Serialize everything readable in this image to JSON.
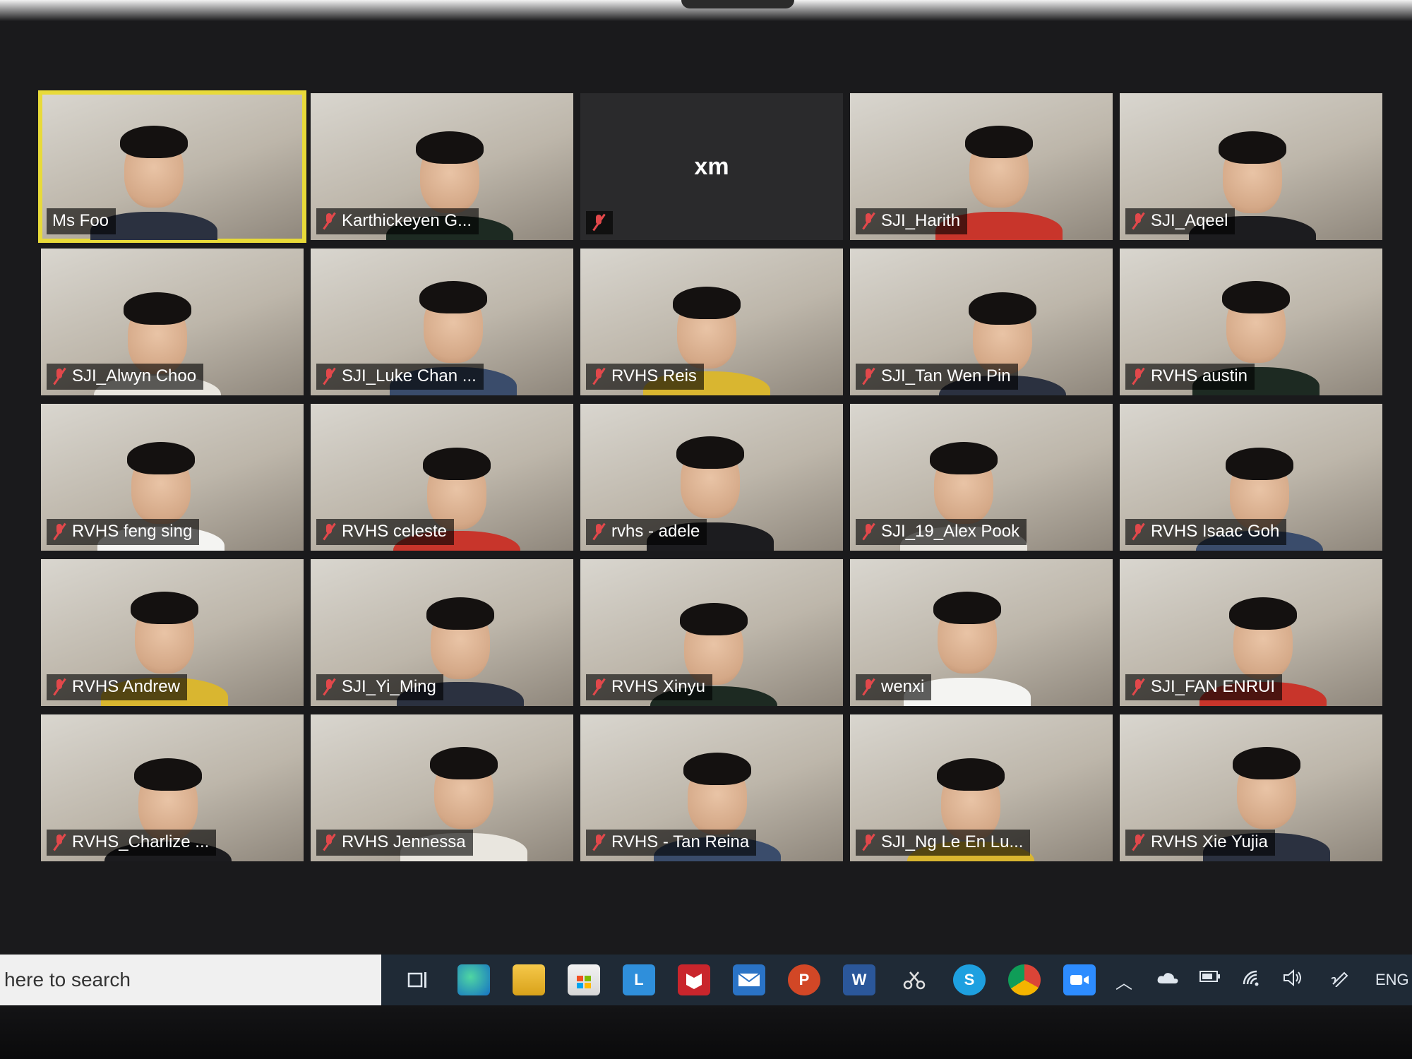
{
  "participants": [
    {
      "name": "Ms Foo",
      "muted": false,
      "speaking": true,
      "video": true
    },
    {
      "name": "Karthickeyen G...",
      "muted": true,
      "video": true
    },
    {
      "name": "",
      "muted": true,
      "video": false,
      "avatar": "xm"
    },
    {
      "name": "SJI_Harith",
      "muted": true,
      "video": true
    },
    {
      "name": "SJI_Aqeel",
      "muted": true,
      "video": true
    },
    {
      "name": "SJI_Alwyn Choo",
      "muted": true,
      "video": true
    },
    {
      "name": "SJI_Luke Chan ...",
      "muted": true,
      "video": true
    },
    {
      "name": "RVHS Reis",
      "muted": true,
      "video": true
    },
    {
      "name": "SJI_Tan Wen Pin",
      "muted": true,
      "video": true
    },
    {
      "name": "RVHS austin",
      "muted": true,
      "video": true
    },
    {
      "name": "RVHS feng sing",
      "muted": true,
      "video": true
    },
    {
      "name": "RVHS celeste",
      "muted": true,
      "video": true
    },
    {
      "name": "rvhs - adele",
      "muted": true,
      "video": true
    },
    {
      "name": "SJI_19_Alex Pook",
      "muted": true,
      "video": true
    },
    {
      "name": "RVHS Isaac Goh",
      "muted": true,
      "video": true
    },
    {
      "name": "RVHS Andrew",
      "muted": true,
      "video": true
    },
    {
      "name": "SJI_Yi_Ming",
      "muted": true,
      "video": true
    },
    {
      "name": "RVHS Xinyu",
      "muted": true,
      "video": true
    },
    {
      "name": "wenxi",
      "muted": true,
      "video": true
    },
    {
      "name": "SJI_FAN ENRUI",
      "muted": true,
      "video": true
    },
    {
      "name": "RVHS_Charlize ...",
      "muted": true,
      "video": true
    },
    {
      "name": "RVHS Jennessa",
      "muted": true,
      "video": true
    },
    {
      "name": "RVHS - Tan Reina",
      "muted": true,
      "video": true
    },
    {
      "name": "SJI_Ng Le En Lu...",
      "muted": true,
      "video": true
    },
    {
      "name": "RVHS Xie Yujia",
      "muted": true,
      "video": true
    }
  ],
  "taskbar": {
    "search_text": "here to search",
    "apps": [
      {
        "icon": "task-view-icon"
      },
      {
        "icon": "edge-icon"
      },
      {
        "icon": "file-explorer-icon"
      },
      {
        "icon": "store-icon"
      },
      {
        "icon": "l-app-icon",
        "text": "L"
      },
      {
        "icon": "mcafee-icon"
      },
      {
        "icon": "mail-icon"
      },
      {
        "icon": "powerpoint-icon",
        "text": "P"
      },
      {
        "icon": "word-icon",
        "text": "W"
      },
      {
        "icon": "snip-icon"
      },
      {
        "icon": "skype-icon",
        "text": "S"
      },
      {
        "icon": "chrome-icon"
      },
      {
        "icon": "zoom-icon"
      }
    ],
    "language": "ENG"
  }
}
